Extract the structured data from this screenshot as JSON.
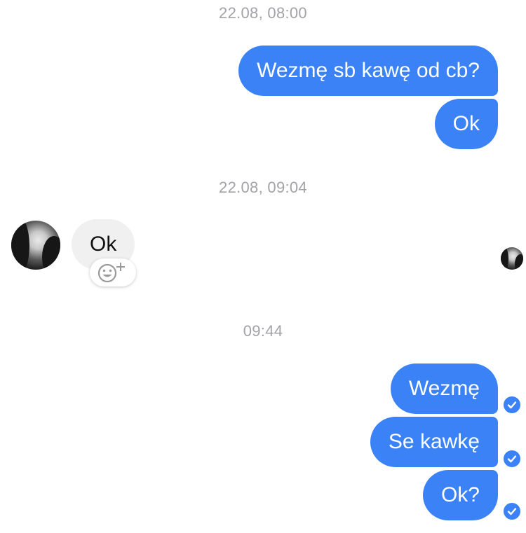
{
  "conversation": {
    "groups": [
      {
        "timestamp": "22.08, 08:00"
      },
      {
        "timestamp": "22.08, 09:04"
      },
      {
        "timestamp": "09:44"
      }
    ],
    "messages": [
      {
        "text": "Wezmę sb kawę od cb?",
        "direction": "outgoing"
      },
      {
        "text": "Ok",
        "direction": "outgoing"
      },
      {
        "text": "Ok",
        "direction": "incoming"
      },
      {
        "text": "Wezmę",
        "direction": "outgoing",
        "status": "delivered"
      },
      {
        "text": "Se kawkę",
        "direction": "outgoing",
        "status": "delivered"
      },
      {
        "text": "Ok?",
        "direction": "outgoing",
        "status": "delivered"
      }
    ]
  },
  "icons": {
    "reaction": "add-reaction-icon",
    "delivered": "check-circle-icon",
    "avatar": "contact-avatar",
    "read_receipt": "read-receipt-avatar"
  },
  "colors": {
    "outgoing_bubble": "#3a82f6",
    "incoming_bubble": "#f0f0f0",
    "timestamp_text": "#a2a2a7"
  }
}
